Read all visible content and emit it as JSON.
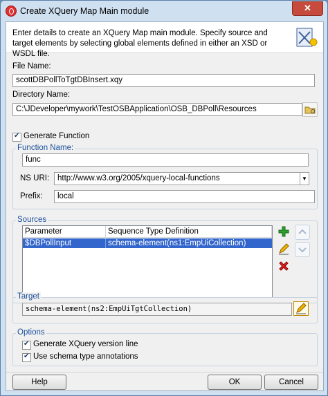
{
  "window": {
    "title": "Create XQuery Map Main module",
    "close_glyph": "✕"
  },
  "header": {
    "description": "Enter details to create an XQuery Map main module. Specify source and target elements by selecting global elements defined in either an XSD or WSDL file."
  },
  "file_name": {
    "label": "File Name:",
    "value": "scottDBPollToTgtDBInsert.xqy"
  },
  "directory_name": {
    "label": "Directory Name:",
    "value": "C:\\JDeveloper\\mywork\\TestOSBApplication\\OSB_DBPoll\\Resources"
  },
  "generate_function": {
    "label": "Generate Function",
    "checked": true
  },
  "function_name": {
    "label": "Function Name:",
    "value": "func"
  },
  "ns_uri": {
    "label": "NS URI:",
    "value": "http://www.w3.org/2005/xquery-local-functions"
  },
  "prefix": {
    "label": "Prefix:",
    "value": "local"
  },
  "sources": {
    "label": "Sources",
    "columns": [
      "Parameter",
      "Sequence Type Definition"
    ],
    "rows": [
      {
        "parameter": "$DBPollInput",
        "type": "schema-element(ns1:EmpUiCollection)"
      }
    ]
  },
  "target": {
    "label": "Target",
    "value": "schema-element(ns2:EmpUiTgtCollection)"
  },
  "options": {
    "label": "Options",
    "generate_version": {
      "label": "Generate XQuery version line",
      "checked": true
    },
    "schema_annotations": {
      "label": "Use schema type annotations",
      "checked": true
    }
  },
  "buttons": {
    "help": "Help",
    "ok": "OK",
    "cancel": "Cancel"
  },
  "colors": {
    "accent": "#1a4f9c",
    "selection": "#3366cc",
    "add": "#2e9e2e",
    "delete": "#d22"
  }
}
